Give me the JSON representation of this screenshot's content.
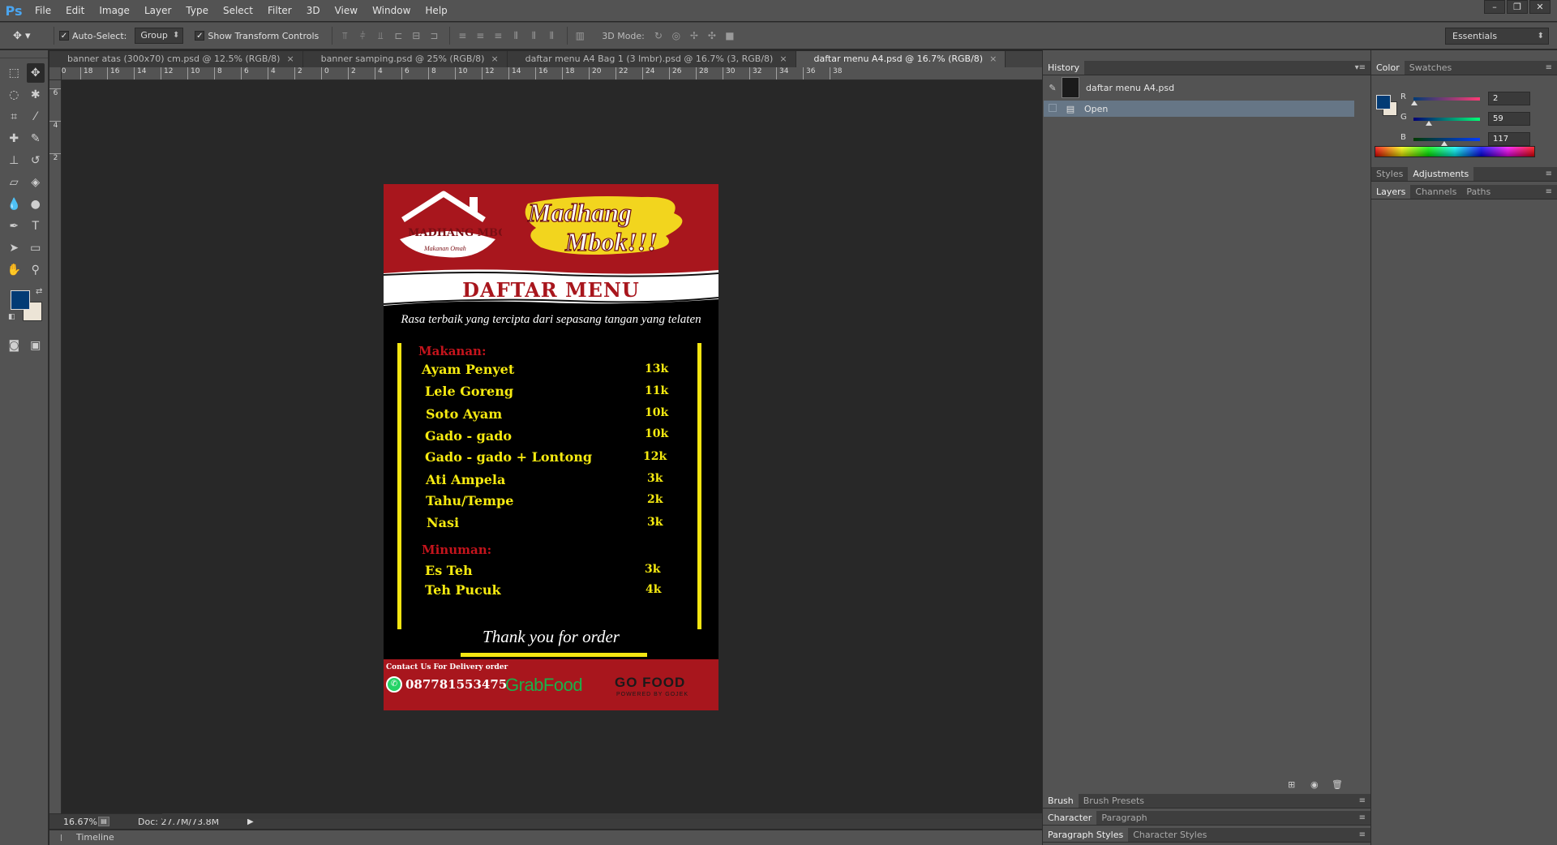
{
  "app": {
    "logo": "Ps",
    "menu": [
      "File",
      "Edit",
      "Image",
      "Layer",
      "Type",
      "Select",
      "Filter",
      "3D",
      "View",
      "Window",
      "Help"
    ],
    "window_buttons": [
      "–",
      "❐",
      "✕"
    ]
  },
  "options_bar": {
    "auto_select_label": "Auto-Select:",
    "auto_select_value": "Group",
    "transform_label": "Show Transform Controls",
    "mode_3d_label": "3D Mode:",
    "workspace": "Essentials"
  },
  "tabs": [
    {
      "label": "banner atas (300x70) cm.psd @ 12.5% (RGB/8)",
      "active": false
    },
    {
      "label": "banner samping.psd @ 25% (RGB/8)",
      "active": false
    },
    {
      "label": "daftar menu A4 Bag 1 (3 lmbr).psd @ 16.7% (3, RGB/8)",
      "active": false
    },
    {
      "label": "daftar menu A4.psd @ 16.7% (RGB/8)",
      "active": true
    }
  ],
  "rulers": {
    "h_ticks": [
      "20",
      "18",
      "16",
      "14",
      "12",
      "10",
      "8",
      "6",
      "4",
      "2",
      "0",
      "2",
      "4",
      "6",
      "8",
      "10",
      "12",
      "14",
      "16",
      "18",
      "20",
      "22",
      "24",
      "26",
      "28",
      "30",
      "32",
      "34",
      "36",
      "38"
    ],
    "v_ticks": [
      "6",
      "4",
      "2"
    ]
  },
  "status": {
    "zoom": "16.67%",
    "doc": "Doc: 27.7M/73.8M",
    "timeline": "Timeline"
  },
  "document": {
    "logo_text": "MADHANG MBOK!!!",
    "logo_sub": "Makanan Omah",
    "brand_line1": "Madhang",
    "brand_line2": "Mbok!!!",
    "title": "DAFTAR MENU",
    "tagline": "Rasa terbaik yang tercipta dari sepasang tangan  yang telaten",
    "food_label": "Makanan:",
    "food_items": [
      {
        "name": "Ayam Penyet",
        "price": "13k"
      },
      {
        "name": "Lele Goreng",
        "price": "11k"
      },
      {
        "name": "Soto Ayam",
        "price": "10k"
      },
      {
        "name": "Gado - gado",
        "price": "10k"
      },
      {
        "name": "Gado - gado + Lontong",
        "price": "12k"
      },
      {
        "name": "Ati Ampela",
        "price": "3k"
      },
      {
        "name": "Tahu/Tempe",
        "price": "2k"
      },
      {
        "name": "Nasi",
        "price": "3k"
      }
    ],
    "drink_label": "Minuman:",
    "drink_items": [
      {
        "name": "Es Teh",
        "price": "3k"
      },
      {
        "name": "Teh Pucuk",
        "price": "4k"
      }
    ],
    "thanks": "Thank you for order",
    "contact_label": "Contact Us For Delivery order",
    "phone": "087781553475",
    "grabfood": "GrabFood",
    "gofood": "GO FOOD",
    "gofood_sub": "POWERED BY GOJEK",
    "colors": {
      "red": "#a8161d",
      "yellow": "#f6ea10",
      "black": "#000000"
    }
  },
  "history_panel": {
    "tab": "History",
    "snapshot": "daftar menu A4.psd",
    "steps": [
      "Open"
    ]
  },
  "color_panel": {
    "tabs": [
      "Color",
      "Swatches"
    ],
    "r": 2,
    "g": 59,
    "b": 117,
    "r_label": "R",
    "g_label": "G",
    "b_label": "B",
    "foreground": "#023b75",
    "background": "#ece4d6"
  },
  "style_tabs": [
    "Styles",
    "Adjustments"
  ],
  "layer_tabs": [
    "Layers",
    "Channels",
    "Paths"
  ],
  "bottom_tabs": {
    "row1": [
      "Brush",
      "Brush Presets"
    ],
    "row2": [
      "Character",
      "Paragraph"
    ],
    "row3": [
      "Paragraph Styles",
      "Character Styles"
    ]
  }
}
